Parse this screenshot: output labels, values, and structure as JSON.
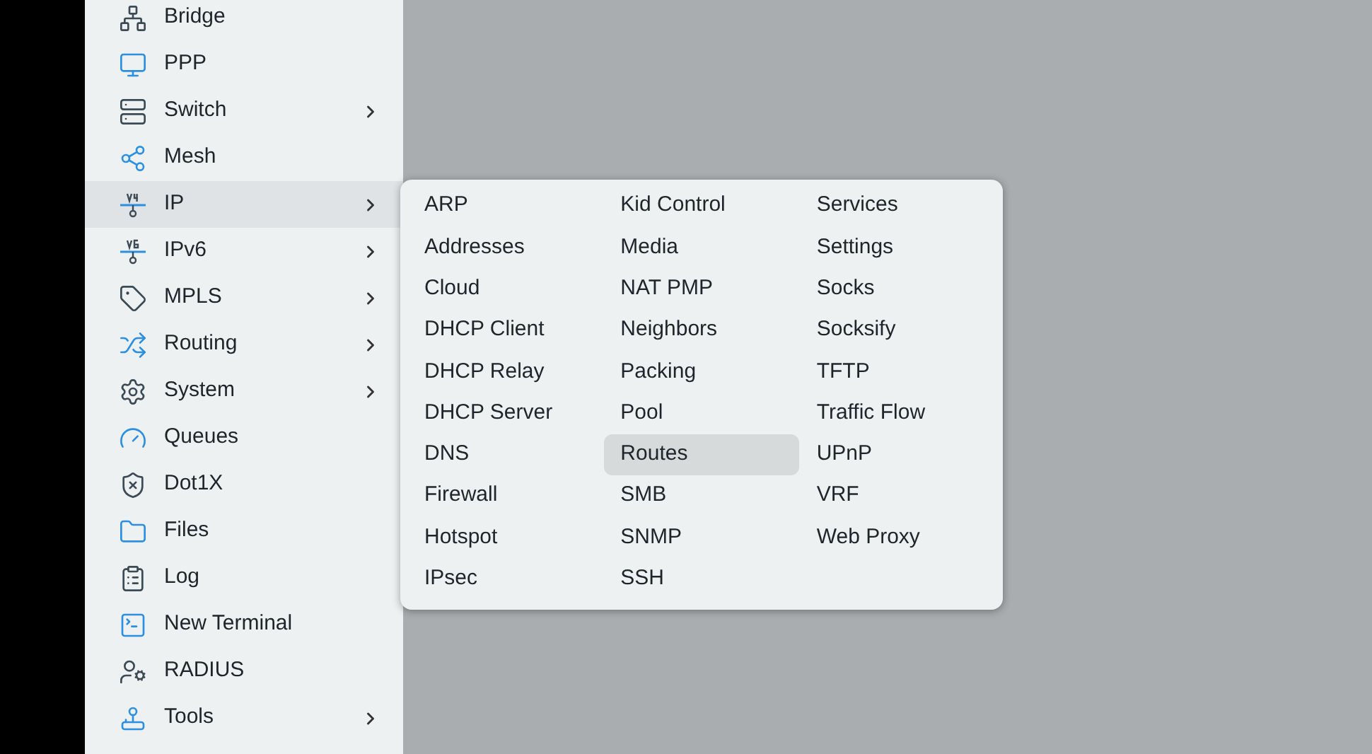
{
  "sidebar": {
    "items": [
      {
        "label": "Bridge",
        "submenu": false,
        "selected": false
      },
      {
        "label": "PPP",
        "submenu": false,
        "selected": false
      },
      {
        "label": "Switch",
        "submenu": true,
        "selected": false
      },
      {
        "label": "Mesh",
        "submenu": false,
        "selected": false
      },
      {
        "label": "IP",
        "submenu": true,
        "selected": true
      },
      {
        "label": "IPv6",
        "submenu": true,
        "selected": false
      },
      {
        "label": "MPLS",
        "submenu": true,
        "selected": false
      },
      {
        "label": "Routing",
        "submenu": true,
        "selected": false
      },
      {
        "label": "System",
        "submenu": true,
        "selected": false
      },
      {
        "label": "Queues",
        "submenu": false,
        "selected": false
      },
      {
        "label": "Dot1X",
        "submenu": false,
        "selected": false
      },
      {
        "label": "Files",
        "submenu": false,
        "selected": false
      },
      {
        "label": "Log",
        "submenu": false,
        "selected": false
      },
      {
        "label": "New Terminal",
        "submenu": false,
        "selected": false
      },
      {
        "label": "RADIUS",
        "submenu": false,
        "selected": false
      },
      {
        "label": "Tools",
        "submenu": true,
        "selected": false
      }
    ]
  },
  "submenu": {
    "columns": [
      [
        {
          "label": "ARP",
          "selected": false
        },
        {
          "label": "Addresses",
          "selected": false
        },
        {
          "label": "Cloud",
          "selected": false
        },
        {
          "label": "DHCP Client",
          "selected": false
        },
        {
          "label": "DHCP Relay",
          "selected": false
        },
        {
          "label": "DHCP Server",
          "selected": false
        },
        {
          "label": "DNS",
          "selected": false
        },
        {
          "label": "Firewall",
          "selected": false
        },
        {
          "label": "Hotspot",
          "selected": false
        },
        {
          "label": "IPsec",
          "selected": false
        }
      ],
      [
        {
          "label": "Kid Control",
          "selected": false
        },
        {
          "label": "Media",
          "selected": false
        },
        {
          "label": "NAT PMP",
          "selected": false
        },
        {
          "label": "Neighbors",
          "selected": false
        },
        {
          "label": "Packing",
          "selected": false
        },
        {
          "label": "Pool",
          "selected": false
        },
        {
          "label": "Routes",
          "selected": true
        },
        {
          "label": "SMB",
          "selected": false
        },
        {
          "label": "SNMP",
          "selected": false
        },
        {
          "label": "SSH",
          "selected": false
        }
      ],
      [
        {
          "label": "Services",
          "selected": false
        },
        {
          "label": "Settings",
          "selected": false
        },
        {
          "label": "Socks",
          "selected": false
        },
        {
          "label": "Socksify",
          "selected": false
        },
        {
          "label": "TFTP",
          "selected": false
        },
        {
          "label": "Traffic Flow",
          "selected": false
        },
        {
          "label": "UPnP",
          "selected": false
        },
        {
          "label": "VRF",
          "selected": false
        },
        {
          "label": "Web Proxy",
          "selected": false
        }
      ]
    ]
  }
}
